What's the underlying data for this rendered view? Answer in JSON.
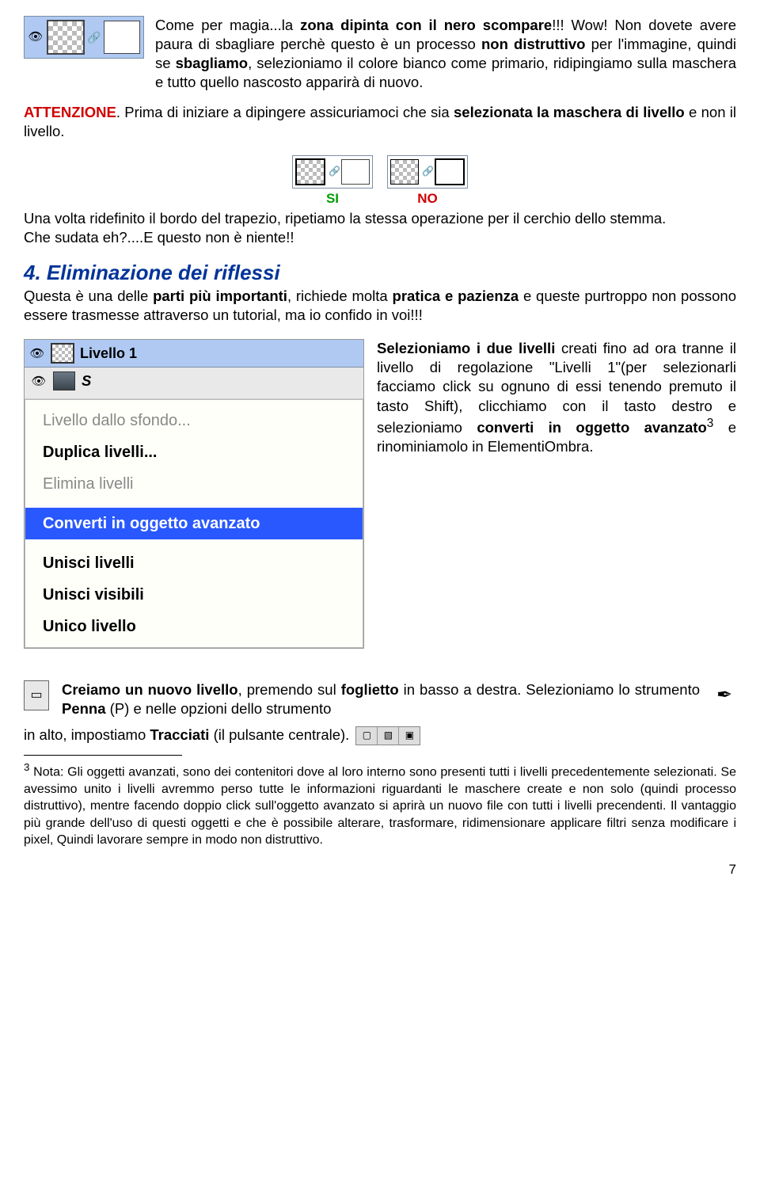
{
  "row1": {
    "para_a": "Come per magia...la ",
    "para_b_bold": "zona dipinta con il nero scompare",
    "para_c": "!!! Wow! Non dovete avere paura di sbagliare perchè questo è un processo ",
    "para_d_bold": "non distruttivo",
    "para_e": " per l'immagine, quindi se ",
    "para_f_bold": "sbagliamo",
    "para_g": ", selezioniamo il colore bianco come primario, ridipingiamo sulla maschera e tutto quello nascosto apparirà di nuovo."
  },
  "attenzione": {
    "label": "ATTENZIONE",
    "text_a": ". Prima di iniziare a dipingere assicuriamoci che sia ",
    "bold_a": "selezionata la maschera di livello",
    "text_b": " e non il livello."
  },
  "sino": {
    "si": "SI",
    "no": "NO",
    "para_a": "Una volta ridefinito il bordo del trapezio, ripetiamo la stessa operazione per il cerchio dello stemma.",
    "para_b": "Che sudata eh?....E questo non è niente!!"
  },
  "section4": {
    "title": "4. Eliminazione dei riflessi",
    "a": "Questa è una delle ",
    "b_bold": "parti più importanti",
    "c": ", richiede molta ",
    "d_bold": "pratica e pazienza",
    "e": " e queste purtroppo non possono essere trasmesse attraverso un tutorial, ma io confido in voi!!!"
  },
  "menu": {
    "layer_name": "Livello 1",
    "sub_letter": "S",
    "items": [
      {
        "label": "Livello dallo sfondo...",
        "state": "disabled"
      },
      {
        "label": "Duplica livelli...",
        "state": "normal"
      },
      {
        "label": "Elimina livelli",
        "state": "disabled"
      },
      {
        "label": "Converti in oggetto avanzato",
        "state": "selected"
      },
      {
        "label": "Unisci livelli",
        "state": "normal"
      },
      {
        "label": "Unisci visibili",
        "state": "normal"
      },
      {
        "label": "Unico livello",
        "state": "normal"
      }
    ],
    "side_a": "Selezioniamo i due livelli",
    "side_b": " creati fino ad ora tranne il livello di regolazione \"Livelli 1\"(per selezionarli facciamo click su ognuno di essi tenendo premuto il tasto Shift), clicchiamo con il tasto destro e selezioniamo ",
    "side_c_bold": "converti in oggetto avanzato",
    "side_sup": "3",
    "side_d": " e rinominiamolo in ElementiOmbra."
  },
  "foot": {
    "a_bold": "Creiamo un nuovo livello",
    "a_txt": ", premendo sul ",
    "b_bold": "foglietto",
    "b_txt": " in basso a destra. Selezioniamo lo strumento ",
    "c_bold": "Penna",
    "c_txt": " (P) e nelle opzioni dello strumento",
    "d": "in alto, impostiamo ",
    "d_bold": "Tracciati",
    "d_end": " (il pulsante centrale). "
  },
  "note": {
    "sup": "3",
    "text": " Nota: Gli oggetti avanzati, sono dei contenitori dove al loro interno sono presenti tutti i livelli precedentemente selezionati. Se avessimo unito i livelli avremmo perso tutte le informazioni riguardanti le maschere create e non solo (quindi processo distruttivo), mentre facendo doppio click sull'oggetto avanzato si aprirà un nuovo file con tutti i livelli precendenti. Il vantaggio più grande dell'uso di questi oggetti e che è possibile alterare, trasformare, ridimensionare applicare filtri senza modificare i pixel, Quindi lavorare sempre in modo non distruttivo."
  },
  "pagenum": "7"
}
